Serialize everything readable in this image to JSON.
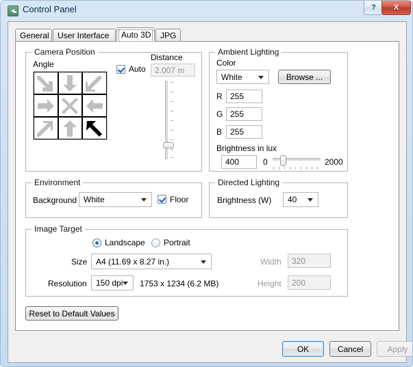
{
  "window": {
    "title": "Control Panel",
    "icon": "back-arrow-icon",
    "help_label": "?",
    "close_label": "X"
  },
  "tabs": [
    {
      "label": "General",
      "active": false
    },
    {
      "label": "User Interface",
      "active": false
    },
    {
      "label": "Auto 3D",
      "active": true
    },
    {
      "label": "JPG",
      "active": false
    }
  ],
  "camera_position": {
    "group_title": "Camera Position",
    "angle_label": "Angle",
    "angle_cells": [
      {
        "name": "angle-top-left",
        "dir": "down-right",
        "selected": false
      },
      {
        "name": "angle-top-center",
        "dir": "down",
        "selected": false
      },
      {
        "name": "angle-top-right",
        "dir": "down-left",
        "selected": false
      },
      {
        "name": "angle-middle-left",
        "dir": "right",
        "selected": false
      },
      {
        "name": "angle-center",
        "dir": "cross",
        "selected": false
      },
      {
        "name": "angle-middle-right",
        "dir": "left",
        "selected": false
      },
      {
        "name": "angle-bottom-left",
        "dir": "up-right",
        "selected": false
      },
      {
        "name": "angle-bottom-center",
        "dir": "up",
        "selected": false
      },
      {
        "name": "angle-bottom-right",
        "dir": "up-left",
        "selected": true
      }
    ],
    "auto_label": "Auto",
    "auto_checked": true,
    "distance_label": "Distance",
    "distance_value": "2.007 m",
    "distance_enabled": false,
    "slider_position_pct": 82
  },
  "ambient_lighting": {
    "group_title": "Ambient Lighting",
    "color_label": "Color",
    "color_value": "White",
    "browse_label": "Browse ...",
    "r_label": "R",
    "r_value": "255",
    "g_label": "G",
    "g_value": "255",
    "b_label": "B",
    "b_value": "255",
    "brightness_label": "Brightness in lux",
    "brightness_value": "400",
    "brightness_min": "0",
    "brightness_max": "2000",
    "brightness_pct": 20
  },
  "environment": {
    "group_title": "Environment",
    "background_label": "Background",
    "background_value": "White",
    "floor_label": "Floor",
    "floor_checked": true
  },
  "directed_lighting": {
    "group_title": "Directed Lighting",
    "brightness_label": "Brightness (W)",
    "brightness_value": "40"
  },
  "image_target": {
    "group_title": "Image Target",
    "landscape_label": "Landscape",
    "portrait_label": "Portrait",
    "orientation": "Landscape",
    "size_label": "Size",
    "size_value": "A4 (11.69 x 8.27 in.)",
    "resolution_label": "Resolution",
    "resolution_value": "150 dpi",
    "pixel_info": "1753 x 1234 (6.2 MB)",
    "width_label": "Width",
    "width_value": "320",
    "height_label": "Height",
    "height_value": "200"
  },
  "reset_button": "Reset to Default Values",
  "footer": {
    "ok_label": "OK",
    "cancel_label": "Cancel",
    "apply_label": "Apply",
    "apply_enabled": false
  },
  "colors": {
    "accent": "#2a8ad4",
    "close_red": "#b93b2d",
    "arrow_gray": "#bfbfbf",
    "arrow_selected": "#000000",
    "window_frame": "#c7dcf0"
  }
}
